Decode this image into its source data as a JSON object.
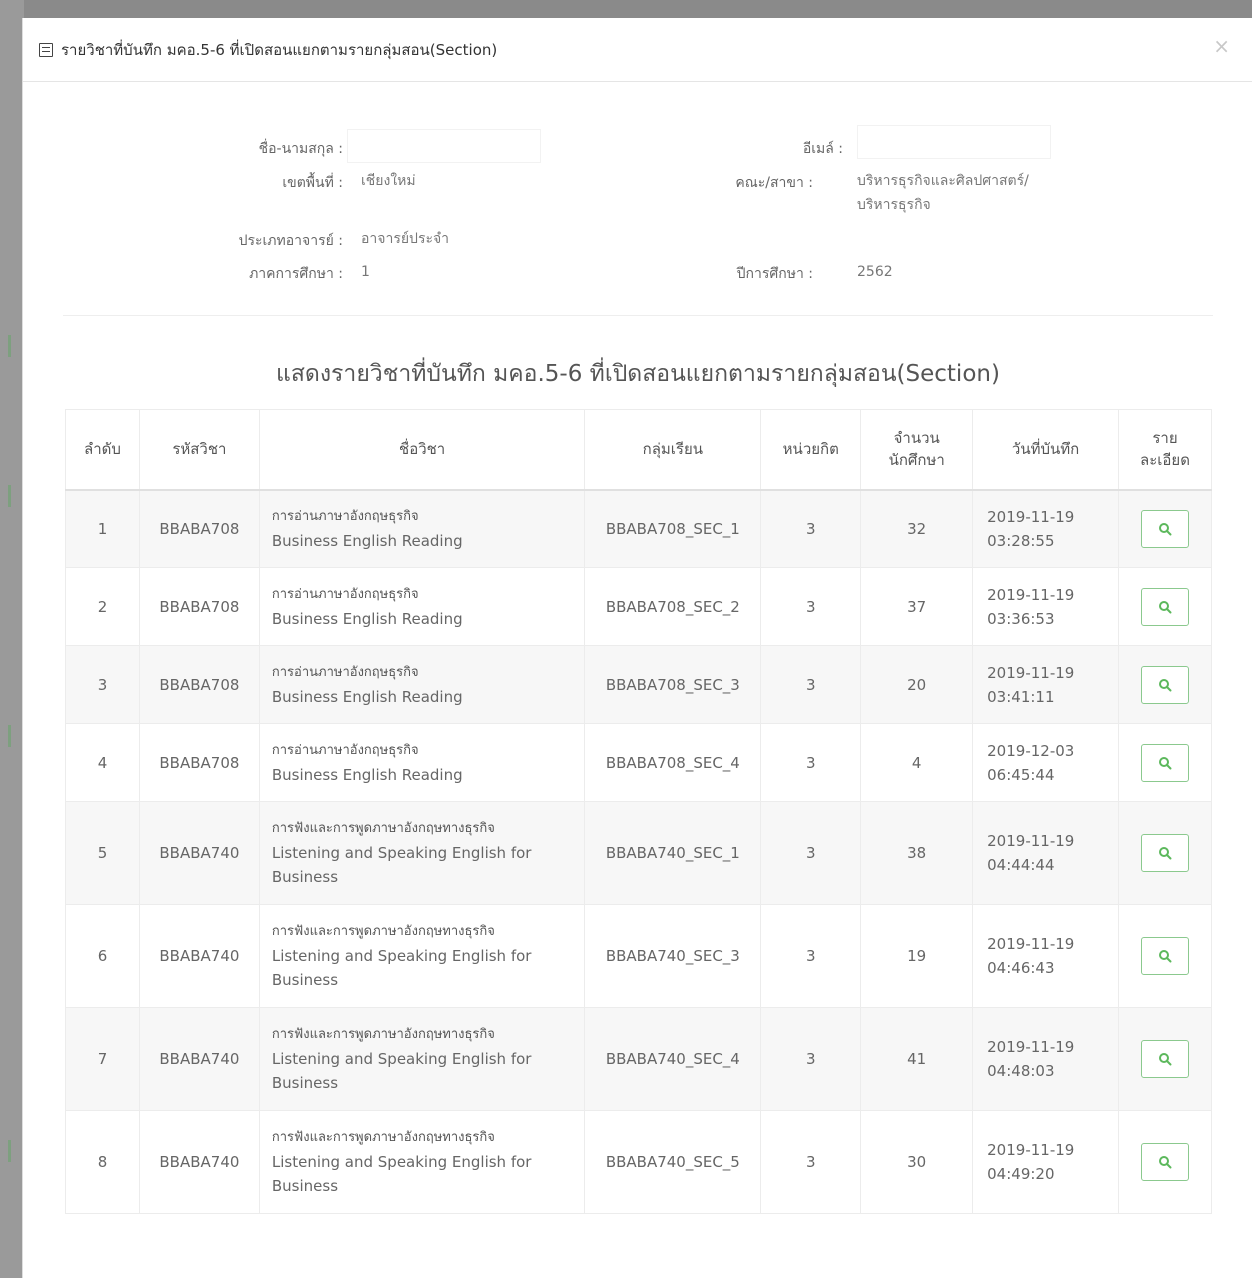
{
  "modal": {
    "title": "รายวิชาที่บันทึก มคอ.5-6 ที่เปิดสอนแยกตามรายกลุ่มสอน(Section)",
    "close": "×"
  },
  "info": {
    "name_label": "ชื่อ-นามสกุล :",
    "email_label": "อีเมล์ :",
    "zone_label": "เขตพื้นที่ :",
    "zone_value": "เชียงใหม่",
    "faculty_label": "คณะ/สาขา :",
    "faculty_value_line1": "บริหารธุรกิจและศิลปศาสตร์/",
    "faculty_value_line2": "บริหารธุรกิจ",
    "teacher_type_label": "ประเภทอาจารย์ :",
    "teacher_type_value": "อาจารย์ประจำ",
    "semester_label": "ภาคการศึกษา :",
    "semester_value": "1",
    "year_label": "ปีการศึกษา :",
    "year_value": "2562"
  },
  "section_title": "แสดงรายวิชาที่บันทึก มคอ.5-6 ที่เปิดสอนแยกตามรายกลุ่มสอน(Section)",
  "table": {
    "headers": {
      "no": "ลำดับ",
      "code": "รหัสวิชา",
      "name": "ชื่อวิชา",
      "group": "กลุ่มเรียน",
      "credit": "หน่วยกิต",
      "students_1": "จำนวน",
      "students_2": "นักศึกษา",
      "date": "วันที่บันทึก",
      "detail_1": "ราย",
      "detail_2": "ละเอียด"
    },
    "rows": [
      {
        "no": "1",
        "code": "BBABA708",
        "name_th": "การอ่านภาษาอังกฤษธุรกิจ",
        "name_en": "Business English Reading",
        "group": "BBABA708_SEC_1",
        "credit": "3",
        "students": "32",
        "date": "2019-11-19",
        "time": "03:28:55"
      },
      {
        "no": "2",
        "code": "BBABA708",
        "name_th": "การอ่านภาษาอังกฤษธุรกิจ",
        "name_en": "Business English Reading",
        "group": "BBABA708_SEC_2",
        "credit": "3",
        "students": "37",
        "date": "2019-11-19",
        "time": "03:36:53"
      },
      {
        "no": "3",
        "code": "BBABA708",
        "name_th": "การอ่านภาษาอังกฤษธุรกิจ",
        "name_en": "Business English Reading",
        "group": "BBABA708_SEC_3",
        "credit": "3",
        "students": "20",
        "date": "2019-11-19",
        "time": "03:41:11"
      },
      {
        "no": "4",
        "code": "BBABA708",
        "name_th": "การอ่านภาษาอังกฤษธุรกิจ",
        "name_en": "Business English Reading",
        "group": "BBABA708_SEC_4",
        "credit": "3",
        "students": "4",
        "date": "2019-12-03",
        "time": "06:45:44"
      },
      {
        "no": "5",
        "code": "BBABA740",
        "name_th": "การฟังและการพูดภาษาอังกฤษทางธุรกิจ",
        "name_en": "Listening and Speaking English for Business",
        "group": "BBABA740_SEC_1",
        "credit": "3",
        "students": "38",
        "date": "2019-11-19",
        "time": "04:44:44"
      },
      {
        "no": "6",
        "code": "BBABA740",
        "name_th": "การฟังและการพูดภาษาอังกฤษทางธุรกิจ",
        "name_en": "Listening and Speaking English for Business",
        "group": "BBABA740_SEC_3",
        "credit": "3",
        "students": "19",
        "date": "2019-11-19",
        "time": "04:46:43"
      },
      {
        "no": "7",
        "code": "BBABA740",
        "name_th": "การฟังและการพูดภาษาอังกฤษทางธุรกิจ",
        "name_en": "Listening and Speaking English for Business",
        "group": "BBABA740_SEC_4",
        "credit": "3",
        "students": "41",
        "date": "2019-11-19",
        "time": "04:48:03"
      },
      {
        "no": "8",
        "code": "BBABA740",
        "name_th": "การฟังและการพูดภาษาอังกฤษทางธุรกิจ",
        "name_en": "Listening and Speaking English for Business",
        "group": "BBABA740_SEC_5",
        "credit": "3",
        "students": "30",
        "date": "2019-11-19",
        "time": "04:49:20"
      }
    ]
  },
  "colors": {
    "accent_green": "#5cb85c",
    "stripe": "#f7f7f7"
  },
  "icons": {
    "title_icon": "list-icon",
    "detail_icon": "search-icon"
  }
}
